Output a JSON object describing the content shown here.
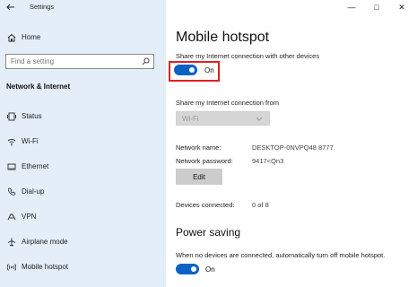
{
  "window": {
    "title": "Settings",
    "controls": [
      "minimize",
      "maximize",
      "close"
    ]
  },
  "sidebar": {
    "home_label": "Home",
    "search_placeholder": "Find a setting",
    "section_title": "Network & Internet",
    "items": [
      {
        "label": "Status",
        "icon": "status-icon"
      },
      {
        "label": "Wi-Fi",
        "icon": "wifi-icon"
      },
      {
        "label": "Ethernet",
        "icon": "ethernet-icon"
      },
      {
        "label": "Dial-up",
        "icon": "dialup-icon"
      },
      {
        "label": "VPN",
        "icon": "vpn-icon"
      },
      {
        "label": "Airplane mode",
        "icon": "airplane-icon"
      },
      {
        "label": "Mobile hotspot",
        "icon": "hotspot-icon"
      }
    ]
  },
  "main": {
    "title": "Mobile hotspot",
    "share_label": "Share my Internet connection with other devices",
    "share_toggle_state": "On",
    "from_label": "Share my Internet connection from",
    "from_value": "Wi-Fi",
    "network_name_label": "Network name:",
    "network_name_value": "DESKTOP-0NVPQ48 8777",
    "network_password_label": "Network password:",
    "network_password_value": "9417<Qn3",
    "edit_label": "Edit",
    "devices_label": "Devices connected:",
    "devices_value": "0 of 8",
    "power_title": "Power saving",
    "power_desc": "When no devices are connected, automatically turn off mobile hotspot.",
    "power_toggle_state": "On"
  },
  "colors": {
    "sidebar_bg": "#e3eef8",
    "accent": "#0a63c4",
    "highlight_border": "#e02020"
  }
}
